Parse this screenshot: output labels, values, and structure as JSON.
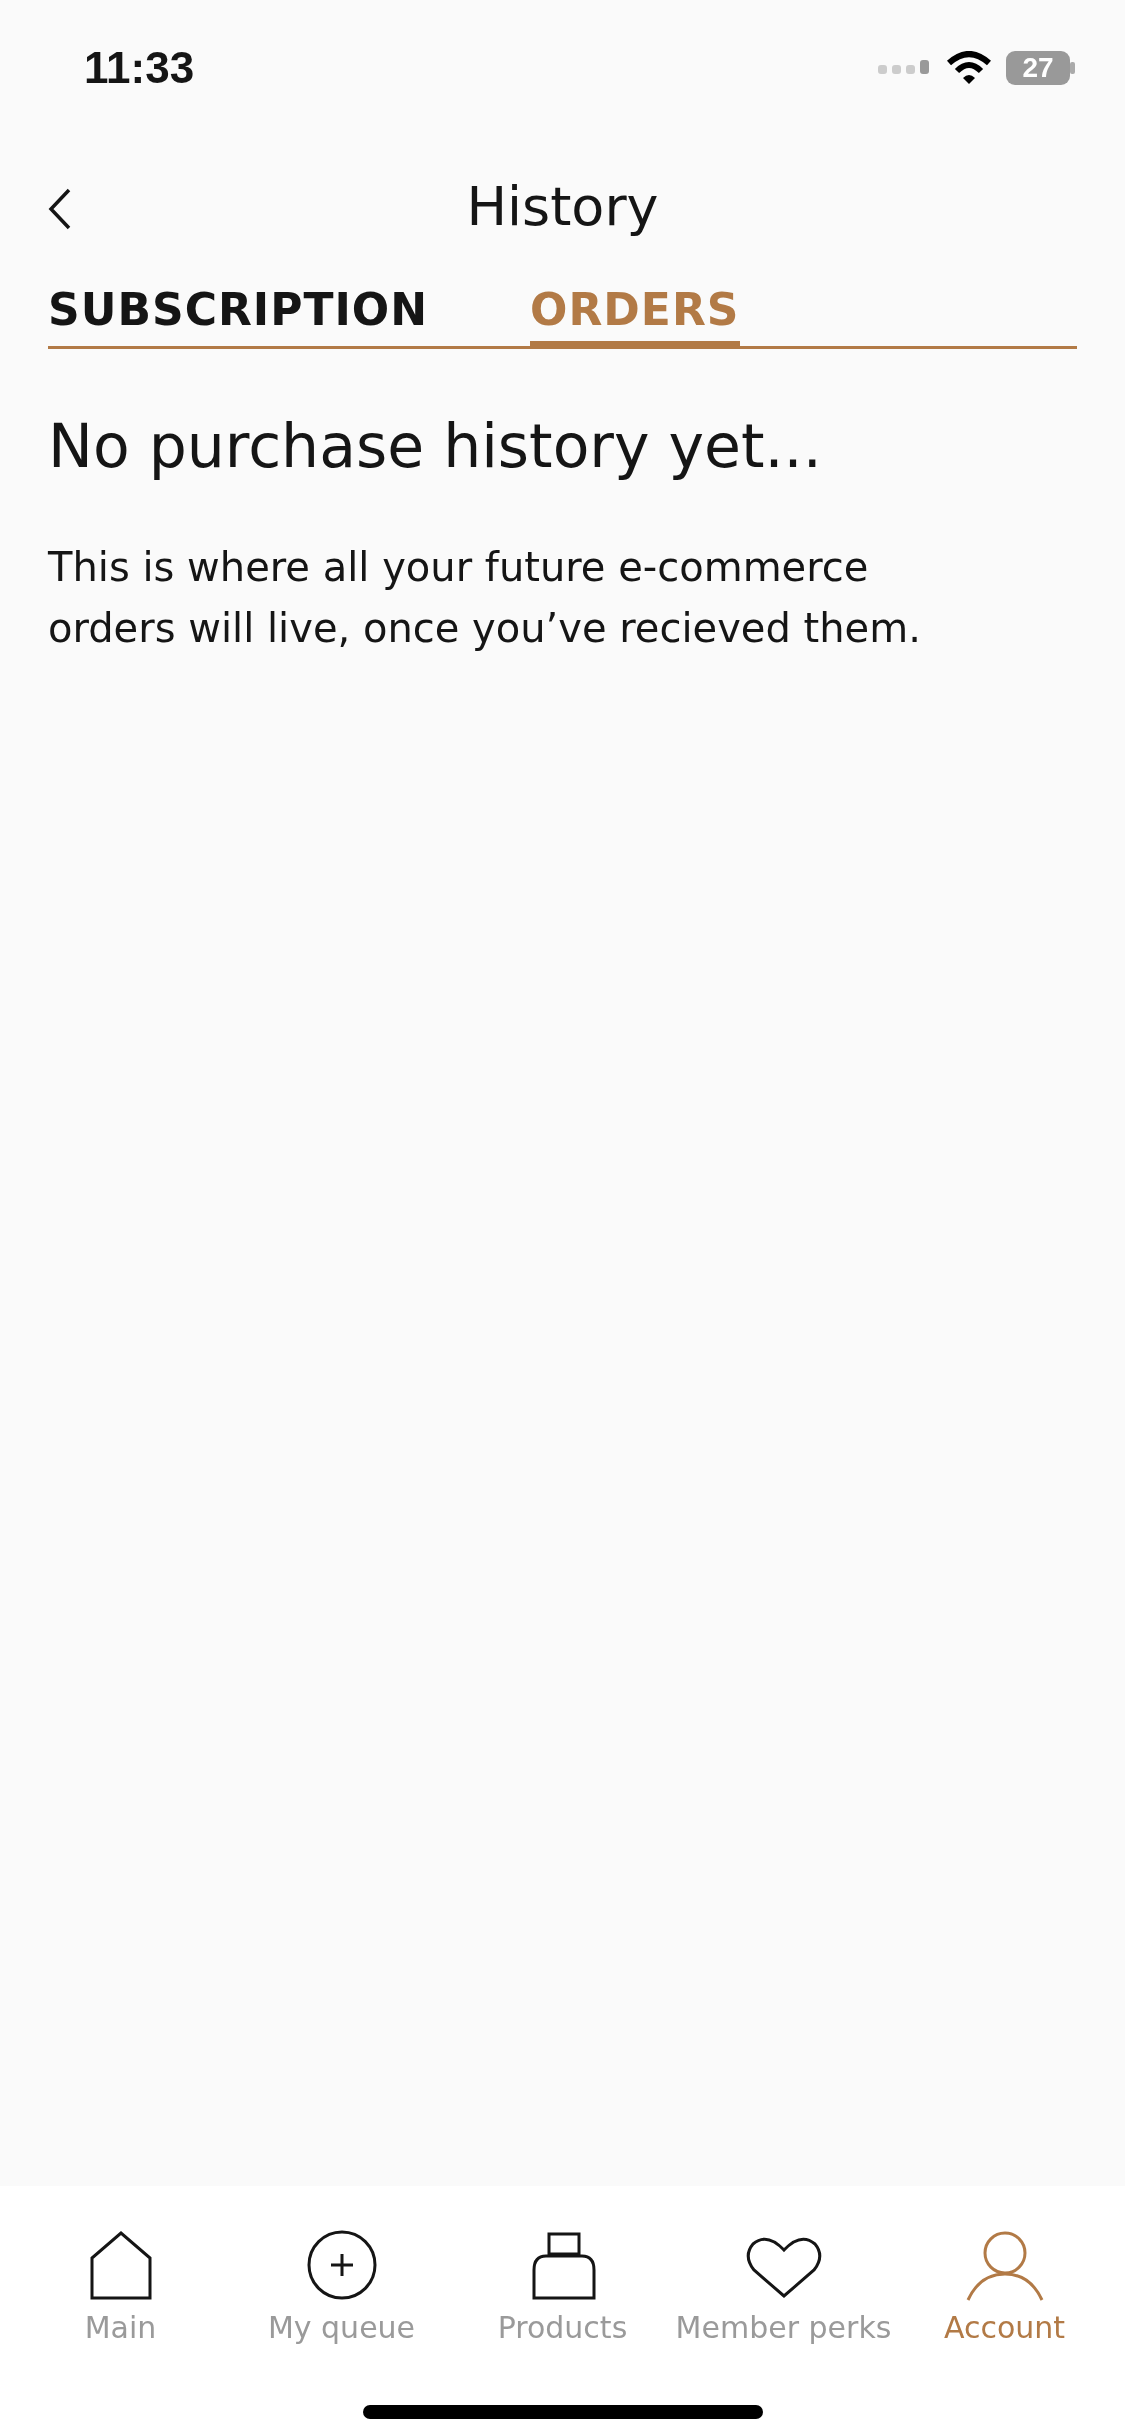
{
  "status_bar": {
    "time": "11:33",
    "battery": "27"
  },
  "header": {
    "title": "History"
  },
  "tabs": [
    {
      "label": "SUBSCRIPTION",
      "selected": false
    },
    {
      "label": "ORDERS",
      "selected": true
    }
  ],
  "empty_state": {
    "heading": "No purchase history yet...",
    "message": "This is where all your future e-commerce orders will live, once you’ve recieved them."
  },
  "nav": [
    {
      "kind": "home",
      "label": "Main",
      "selected": false
    },
    {
      "kind": "add",
      "label": "My queue",
      "selected": false
    },
    {
      "kind": "product",
      "label": "Products",
      "selected": false
    },
    {
      "kind": "heart",
      "label": "Member perks",
      "selected": false
    },
    {
      "kind": "person",
      "label": "Account",
      "selected": true
    }
  ]
}
